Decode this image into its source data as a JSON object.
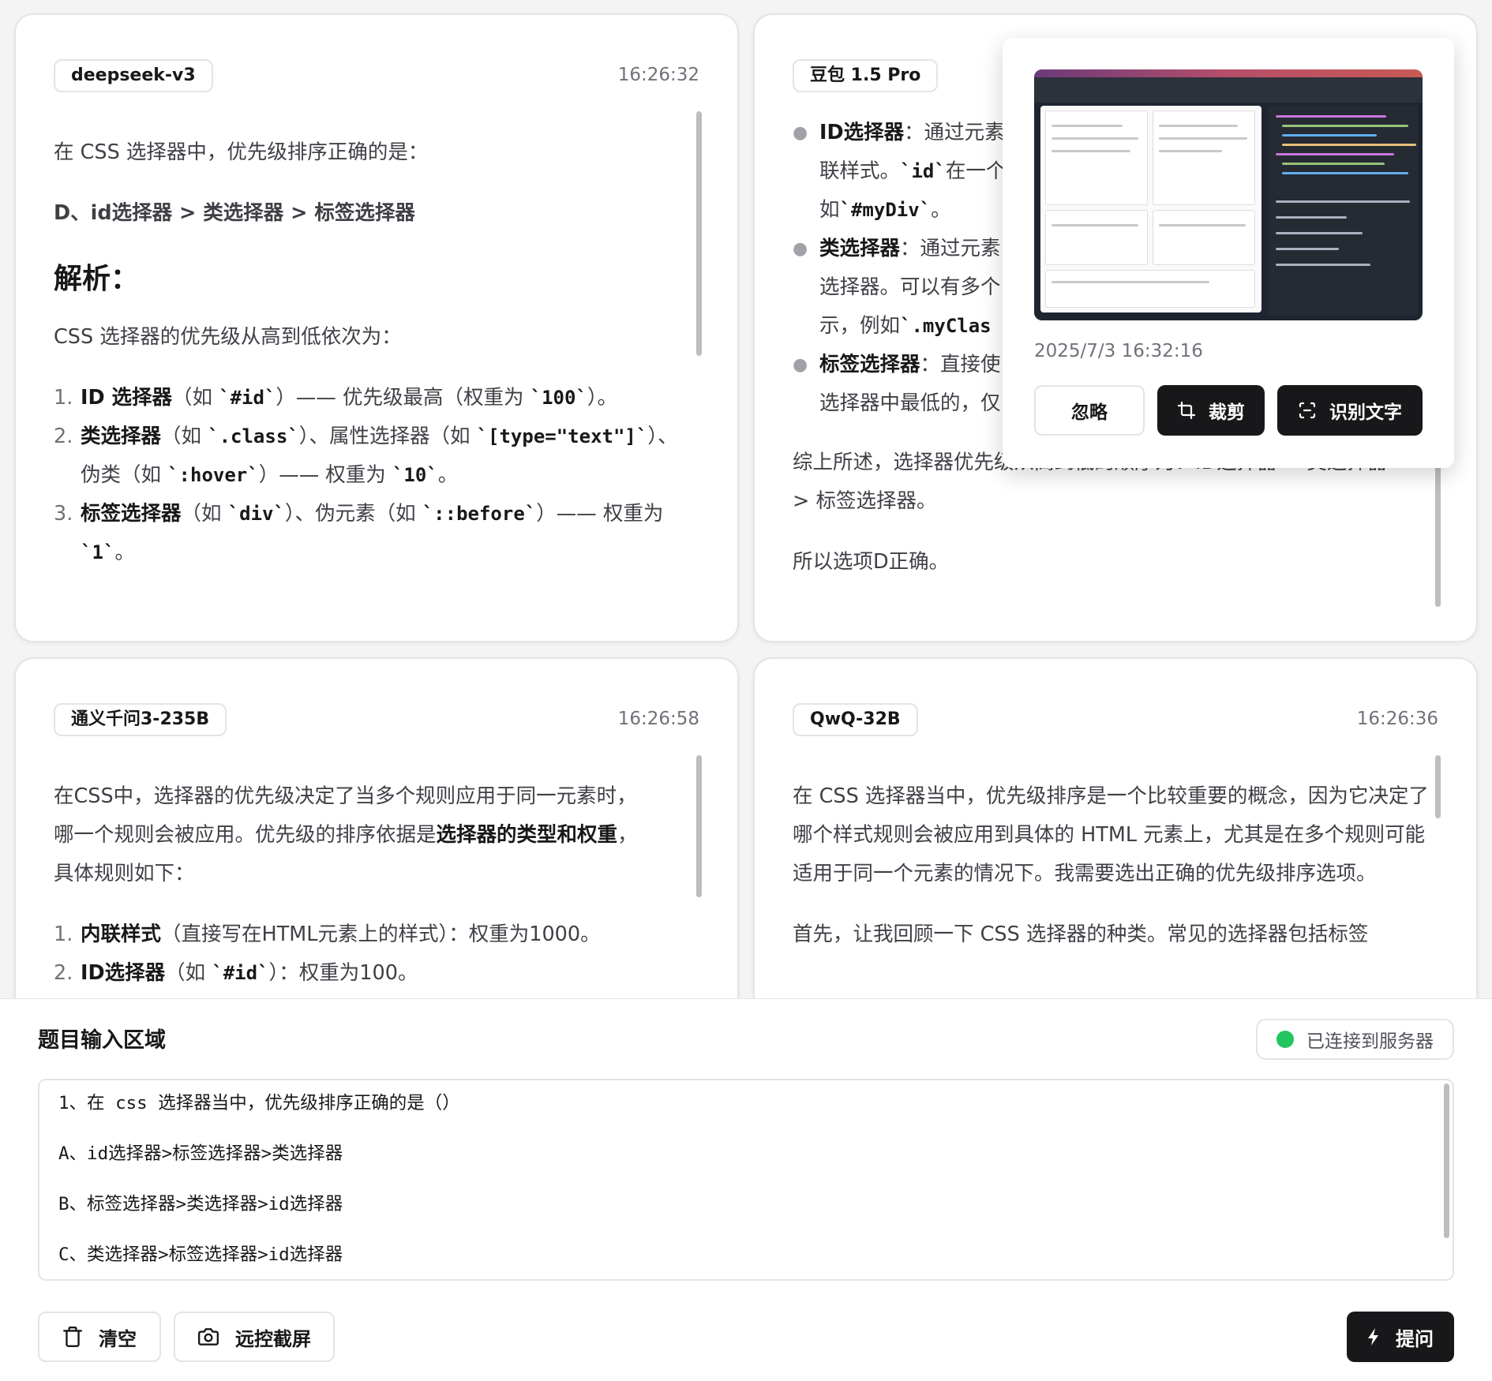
{
  "cards": [
    {
      "model": "deepseek-v3",
      "time": "16:26:32",
      "intro": "在 CSS 选择器中，优先级排序正确的是：",
      "answer": "D、id选择器 > 类选择器 > 标签选择器",
      "heading": "解析：",
      "order_text": "CSS 选择器的优先级从高到低依次为：",
      "items": [
        {
          "num": "1.",
          "bold": "ID 选择器",
          "t1": "（如 ",
          "c1": "`#id`",
          "t2": "）—— 优先级最高（权重为 ",
          "c2": "`100`",
          "t3": "）。"
        },
        {
          "num": "2.",
          "bold": "类选择器",
          "t1": "（如 ",
          "c1": "`.class`",
          "t2": "）、属性选择器（如 ",
          "c2": "`[type=\"text\"]`",
          "t3": "）、伪类（如 ",
          "c3": "`:hover`",
          "t4": "）—— 权重为 ",
          "c4": "`10`",
          "t5": "。"
        },
        {
          "num": "3.",
          "bold": "标签选择器",
          "t1": "（如 ",
          "c1": "`div`",
          "t2": "）、伪元素（如 ",
          "c2": "`::before`",
          "t3": "）—— 权重为 ",
          "c3": "`1`",
          "t4": "。"
        }
      ]
    },
    {
      "model": "豆包 1.5 Pro",
      "time": "",
      "items": [
        {
          "bold": "ID选择器",
          "t1": "：通过元素",
          "l2a": "联样式。",
          "c1": "`id`",
          "l2b": "在一个",
          "l3a": "如",
          "c2": "`#myDiv`",
          "l3b": "。"
        },
        {
          "bold": "类选择器",
          "t1": "：通过元素",
          "l2": "选择器。可以有多个",
          "l3a": "示，例如",
          "c1": "`.myClas"
        },
        {
          "bold": "标签选择器",
          "t1": "：直接使",
          "l2": "选择器中最低的，仅"
        }
      ],
      "summary_a": "综上所述，选择器优先级从高到低的顺序为：ID选择器 > 类选择器",
      "summary_b": "> 标签选择器。",
      "conclusion": "所以选项D正确。"
    },
    {
      "model": "通义千问3-235B",
      "time": "16:26:58",
      "intro_a": "在CSS中，选择器的优先级决定了当多个规则应用于同一元素时，",
      "intro_b": "哪一个规则会被应用。优先级的排序依据是",
      "intro_bold": "选择器的类型和权重",
      "intro_c": "，",
      "intro_d": "具体规则如下：",
      "items": [
        {
          "num": "1.",
          "bold": "内联样式",
          "t1": "（直接写在HTML元素上的样式）：权重为1000。"
        },
        {
          "num": "2.",
          "bold": "ID选择器",
          "t1": "（如 ",
          "c1": "`#id`",
          "t2": "）：权重为100。"
        }
      ]
    },
    {
      "model": "QwQ-32B",
      "time": "16:26:36",
      "para1": "在 CSS 选择器当中，优先级排序是一个比较重要的概念，因为它决定了哪个样式规则会被应用到具体的 HTML 元素上，尤其是在多个规则可能适用于同一个元素的情况下。我需要选出正确的优先级排序选项。",
      "para2": "首先，让我回顾一下 CSS 选择器的种类。常见的选择器包括标签"
    }
  ],
  "popup": {
    "time": "2025/7/3 16:32:16",
    "ignore_label": "忽略",
    "crop_label": "裁剪",
    "ocr_label": "识别文字"
  },
  "bottom": {
    "title": "题目输入区域",
    "status": "已连接到服务器",
    "status_color": "#22c55e",
    "question_lines": [
      "1、在 css 选择器当中，优先级排序正确的是（）",
      "A、id选择器>标签选择器>类选择器",
      "B、标签选择器>类选择器>id选择器",
      "C、类选择器>标签选择器>id选择器"
    ],
    "clear_label": "清空",
    "screenshot_label": "远控截屏",
    "ask_label": "提问"
  }
}
